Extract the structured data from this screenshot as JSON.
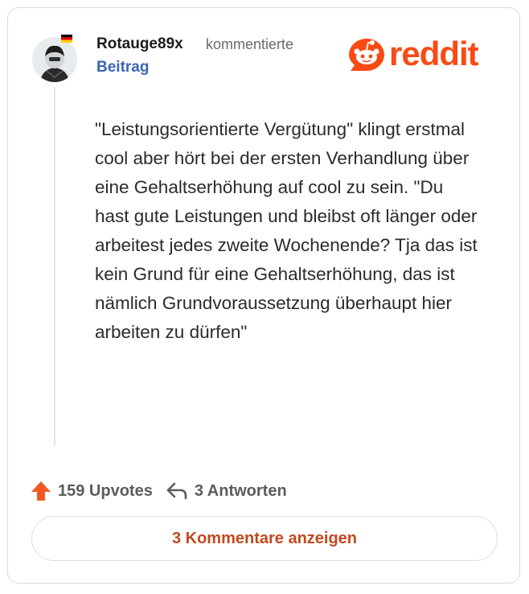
{
  "comment": {
    "author": "Rotauge89x",
    "action": "kommentierte",
    "post_link": "Beitrag",
    "text": "\"Leistungsorientierte Vergütung\" klingt erstmal cool aber hört bei der ersten Verhandlung über eine Gehaltserhöhung auf cool zu sein. \"Du hast gute Leistungen und bleibst oft länger oder arbeitest jedes zweite Wochenende? Tja das ist kein Grund für eine Gehaltserhöhung, das ist nämlich Grundvoraussetzung überhaupt hier arbeiten zu dürfen\""
  },
  "brand": {
    "name": "reddit",
    "color": "#fa4a14"
  },
  "footer": {
    "upvotes": "159 Upvotes",
    "replies": "3 Antworten",
    "upvote_color": "#f05a22"
  },
  "show_comments": {
    "label": "3 Kommentare anzeigen"
  },
  "icons": [
    "avatar",
    "german-flag-icon",
    "reddit-logo-icon",
    "upvote-arrow-icon",
    "reply-arrow-icon"
  ]
}
